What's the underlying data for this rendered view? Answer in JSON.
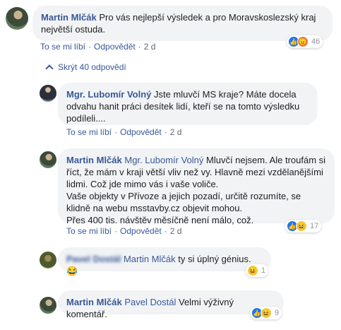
{
  "thread": {
    "comments": [
      {
        "author": "Martin Mlčák",
        "mention": "",
        "text": "Pro vás nejlepší výsledek a pro Moravskoslezský kraj největší ostuda.",
        "like_label": "To se mi líbí",
        "reply_label": "Odpovědět",
        "time": "2 d",
        "reaction_count": "46"
      },
      {
        "author": "Mgr. Lubomír Volný",
        "mention": "",
        "text": "Jste mluvčí MS kraje? Máte docela odvahu hanit práci desítek lidí, kteří se na tomto výsledku podíleli....",
        "like_label": "To se mi líbí",
        "reply_label": "Odpovědět",
        "time": "2 d"
      },
      {
        "author": "Martin Mlčák",
        "mention": "Mgr. Lubomír Volný",
        "text": "Mluvčí nejsem. Ale troufám si říct, že mám v kraji větší vliv než vy. Hlavně mezi vzdělanějšími lidmi. Což jde mimo vás i vaše voliče.\nVaše objekty v Přívoze a jejich pozadí, určitě rozumíte, se klidně na webu msstavby.cz objevit mohou.\nPřes 400 tis. návštěv měsíčně není málo, což.",
        "like_label": "To se mi líbí",
        "reply_label": "Odpovědět",
        "time": "2 d",
        "reaction_count": "17"
      },
      {
        "author": "Pavel Dostál",
        "mention": "Martin Mlčák",
        "text": "ty si úplný génius.",
        "emoji": "😂",
        "reaction_count": "1"
      },
      {
        "author": "Martin Mlčák",
        "mention": "Pavel Dostál",
        "text": "Velmi výživný komentář.",
        "reaction_count": "9"
      }
    ],
    "toggle_label": "Skrýt 40 odpovědí"
  },
  "colors": {
    "link": "#385898",
    "bubble": "#f2f3f5",
    "meta": "#616770",
    "like": "#1877f2"
  },
  "icons": {
    "like": "like-reaction-icon",
    "angry": "angry-reaction-icon",
    "haha": "haha-reaction-icon"
  }
}
